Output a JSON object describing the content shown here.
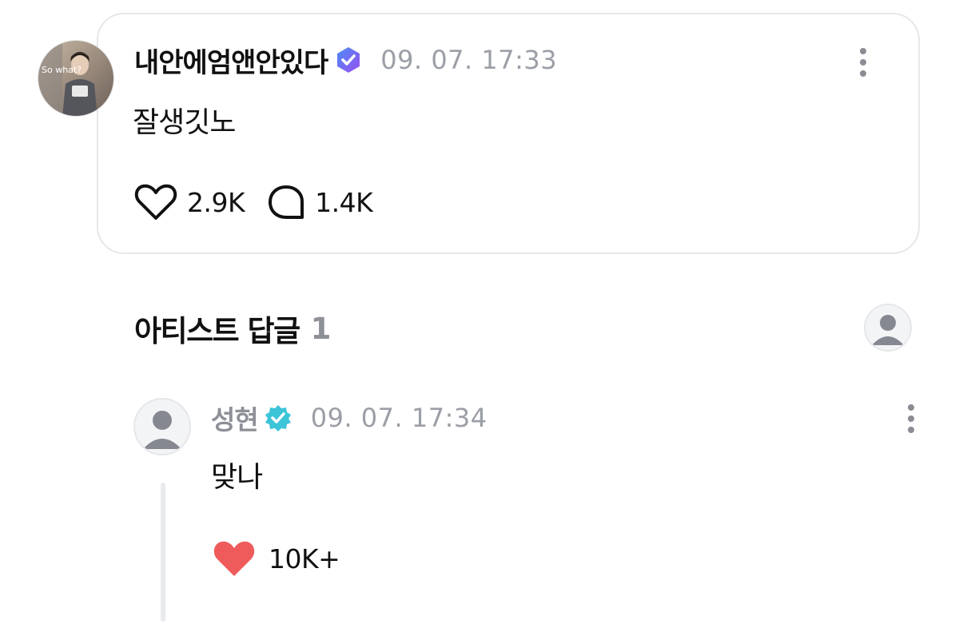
{
  "post": {
    "author": "내안에엄앤안있다",
    "timestamp": "09. 07. 17:33",
    "text": "잘생깃노",
    "avatar_caption": "So what?",
    "likes": "2.9K",
    "comments": "1.4K",
    "icons": {
      "badge": "fan-verified-badge-icon",
      "like": "heart-outline-icon",
      "comment": "comment-bubble-icon",
      "more": "more-vertical-icon"
    }
  },
  "artist_replies": {
    "title": "아티스트 답글",
    "count": "1"
  },
  "reply": {
    "author": "성현",
    "timestamp": "09. 07. 17:34",
    "text": "맞나",
    "likes": "10K+",
    "icons": {
      "badge": "artist-verified-badge-icon",
      "like": "heart-filled-icon",
      "more": "more-vertical-icon"
    }
  },
  "colors": {
    "fan_badge": "#7b5cf0",
    "artist_badge": "#3cc4d8",
    "heart_filled": "#ef5b5b",
    "muted_text": "#9b9ea6",
    "card_border": "#e6e7eb"
  }
}
